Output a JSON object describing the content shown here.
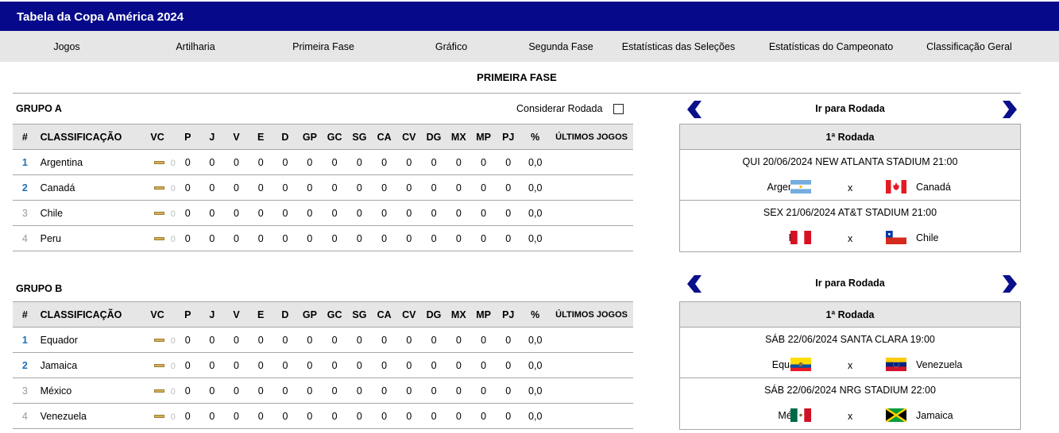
{
  "app": {
    "title": "Tabela da Copa América 2024"
  },
  "nav": [
    "Jogos",
    "Artilharia",
    "Primeira Fase",
    "Gráfico",
    "Segunda Fase",
    "Estatísticas das Seleções",
    "Estatísticas do Campeonato",
    "Classificação Geral"
  ],
  "section_title": "PRIMEIRA FASE",
  "consider_label": "Considerar Rodada",
  "consider_checked": false,
  "columns": [
    "#",
    "CLASSIFICAÇÃO",
    "VC",
    "P",
    "J",
    "V",
    "E",
    "D",
    "GP",
    "GC",
    "SG",
    "CA",
    "CV",
    "DG",
    "MX",
    "MP",
    "PJ",
    "%",
    "ÚLTIMOS JOGOS"
  ],
  "groups": [
    {
      "title": "GRUPO A",
      "rows": [
        {
          "pos": "1",
          "team": "Argentina",
          "vc": "0",
          "stats": [
            "0",
            "0",
            "0",
            "0",
            "0",
            "0",
            "0",
            "0",
            "0",
            "0",
            "0",
            "0",
            "0",
            "0"
          ],
          "pct": "0,0",
          "last": ""
        },
        {
          "pos": "2",
          "team": "Canadá",
          "vc": "0",
          "stats": [
            "0",
            "0",
            "0",
            "0",
            "0",
            "0",
            "0",
            "0",
            "0",
            "0",
            "0",
            "0",
            "0",
            "0"
          ],
          "pct": "0,0",
          "last": ""
        },
        {
          "pos": "3",
          "team": "Chile",
          "vc": "0",
          "stats": [
            "0",
            "0",
            "0",
            "0",
            "0",
            "0",
            "0",
            "0",
            "0",
            "0",
            "0",
            "0",
            "0",
            "0"
          ],
          "pct": "0,0",
          "last": ""
        },
        {
          "pos": "4",
          "team": "Peru",
          "vc": "0",
          "stats": [
            "0",
            "0",
            "0",
            "0",
            "0",
            "0",
            "0",
            "0",
            "0",
            "0",
            "0",
            "0",
            "0",
            "0"
          ],
          "pct": "0,0",
          "last": ""
        }
      ],
      "round_nav_label": "Ir para Rodada",
      "round_title": "1ª Rodada",
      "matches": [
        {
          "info": "QUI 20/06/2024 NEW ATLANTA STADIUM 21:00",
          "home": "Argentina",
          "home_flag": "argentina",
          "vs": "x",
          "away": "Canadá",
          "away_flag": "canada"
        },
        {
          "info": "SEX 21/06/2024 AT&T STADIUM 21:00",
          "home": "Peru",
          "home_flag": "peru",
          "vs": "x",
          "away": "Chile",
          "away_flag": "chile"
        }
      ]
    },
    {
      "title": "GRUPO B",
      "rows": [
        {
          "pos": "1",
          "team": "Equador",
          "vc": "0",
          "stats": [
            "0",
            "0",
            "0",
            "0",
            "0",
            "0",
            "0",
            "0",
            "0",
            "0",
            "0",
            "0",
            "0",
            "0"
          ],
          "pct": "0,0",
          "last": ""
        },
        {
          "pos": "2",
          "team": "Jamaica",
          "vc": "0",
          "stats": [
            "0",
            "0",
            "0",
            "0",
            "0",
            "0",
            "0",
            "0",
            "0",
            "0",
            "0",
            "0",
            "0",
            "0"
          ],
          "pct": "0,0",
          "last": ""
        },
        {
          "pos": "3",
          "team": "México",
          "vc": "0",
          "stats": [
            "0",
            "0",
            "0",
            "0",
            "0",
            "0",
            "0",
            "0",
            "0",
            "0",
            "0",
            "0",
            "0",
            "0"
          ],
          "pct": "0,0",
          "last": ""
        },
        {
          "pos": "4",
          "team": "Venezuela",
          "vc": "0",
          "stats": [
            "0",
            "0",
            "0",
            "0",
            "0",
            "0",
            "0",
            "0",
            "0",
            "0",
            "0",
            "0",
            "0",
            "0"
          ],
          "pct": "0,0",
          "last": ""
        }
      ],
      "round_nav_label": "Ir para Rodada",
      "round_title": "1ª Rodada",
      "matches": [
        {
          "info": "SÁB 22/06/2024 SANTA CLARA 19:00",
          "home": "Equador",
          "home_flag": "ecuador",
          "vs": "x",
          "away": "Venezuela",
          "away_flag": "venezuela"
        },
        {
          "info": "SÁB 22/06/2024 NRG STADIUM 22:00",
          "home": "México",
          "home_flag": "mexico",
          "vs": "x",
          "away": "Jamaica",
          "away_flag": "jamaica"
        }
      ]
    }
  ],
  "colors": {
    "header": "#060a8a",
    "nav_bg": "#e6e6e6",
    "arrow": "#0a0f8c",
    "top_pos": "#1f6fb5"
  }
}
